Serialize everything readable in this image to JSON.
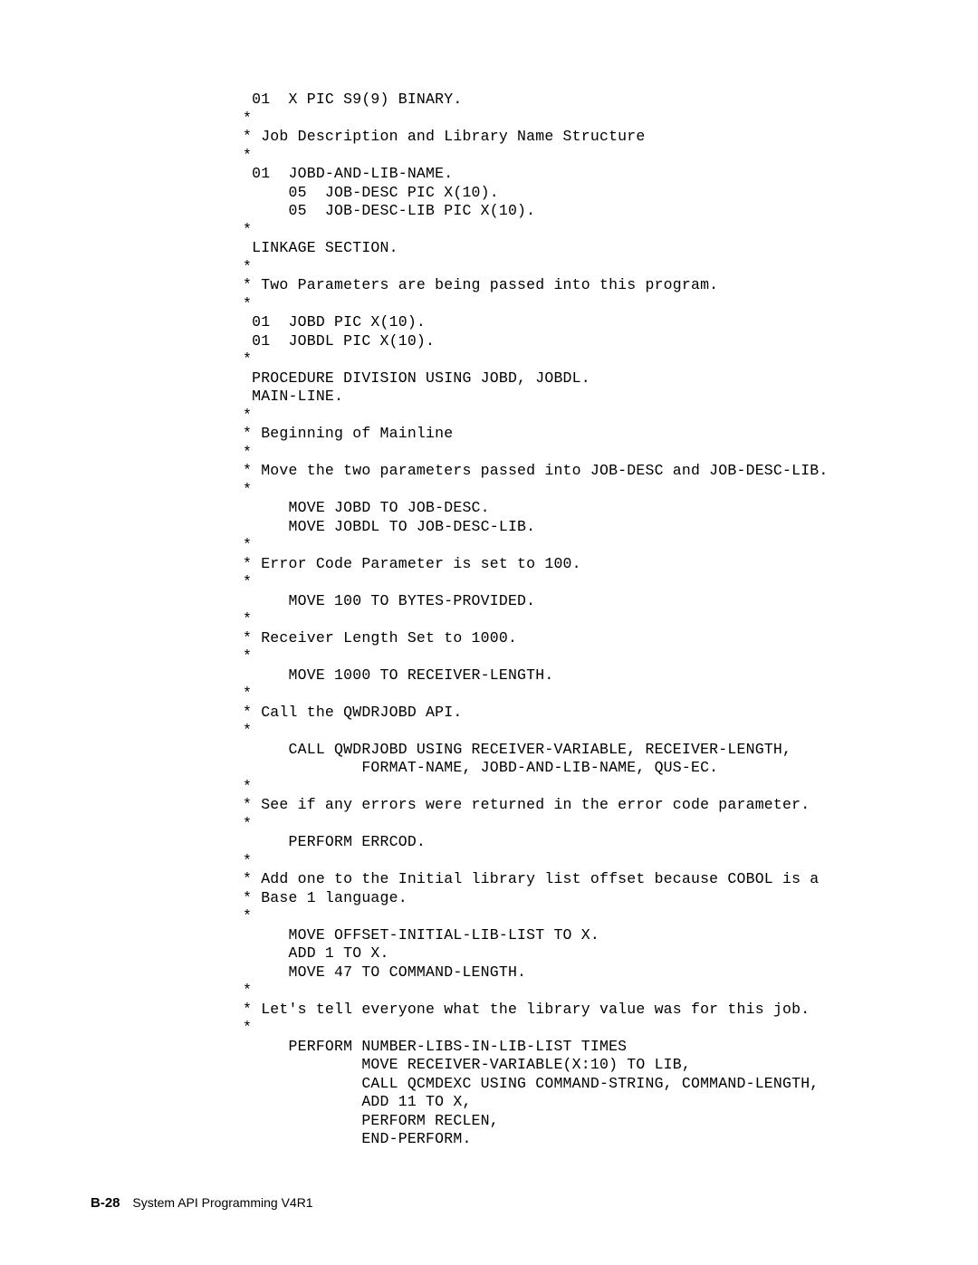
{
  "code_lines": [
    " 01  X PIC S9(9) BINARY.",
    "*",
    "* Job Description and Library Name Structure",
    "*",
    " 01  JOBD-AND-LIB-NAME.",
    "     05  JOB-DESC PIC X(10).",
    "     05  JOB-DESC-LIB PIC X(10).",
    "*",
    " LINKAGE SECTION.",
    "*",
    "* Two Parameters are being passed into this program.",
    "*",
    " 01  JOBD PIC X(10).",
    " 01  JOBDL PIC X(10).",
    "*",
    " PROCEDURE DIVISION USING JOBD, JOBDL.",
    " MAIN-LINE.",
    "*",
    "* Beginning of Mainline",
    "*",
    "* Move the two parameters passed into JOB-DESC and JOB-DESC-LIB.",
    "*",
    "     MOVE JOBD TO JOB-DESC.",
    "     MOVE JOBDL TO JOB-DESC-LIB.",
    "*",
    "* Error Code Parameter is set to 100.",
    "*",
    "     MOVE 100 TO BYTES-PROVIDED.",
    "*",
    "* Receiver Length Set to 1000.",
    "*",
    "     MOVE 1000 TO RECEIVER-LENGTH.",
    "*",
    "* Call the QWDRJOBD API.",
    "*",
    "     CALL QWDRJOBD USING RECEIVER-VARIABLE, RECEIVER-LENGTH,",
    "             FORMAT-NAME, JOBD-AND-LIB-NAME, QUS-EC.",
    "*",
    "* See if any errors were returned in the error code parameter.",
    "*",
    "     PERFORM ERRCOD.",
    "*",
    "* Add one to the Initial library list offset because COBOL is a",
    "* Base 1 language.",
    "*",
    "     MOVE OFFSET-INITIAL-LIB-LIST TO X.",
    "     ADD 1 TO X.",
    "     MOVE 47 TO COMMAND-LENGTH.",
    "*",
    "* Let's tell everyone what the library value was for this job.",
    "*",
    "     PERFORM NUMBER-LIBS-IN-LIB-LIST TIMES",
    "             MOVE RECEIVER-VARIABLE(X:10) TO LIB,",
    "             CALL QCMDEXC USING COMMAND-STRING, COMMAND-LENGTH,",
    "             ADD 11 TO X,",
    "             PERFORM RECLEN,",
    "             END-PERFORM."
  ],
  "footer": {
    "page": "B-28",
    "title": "System API Programming V4R1"
  }
}
